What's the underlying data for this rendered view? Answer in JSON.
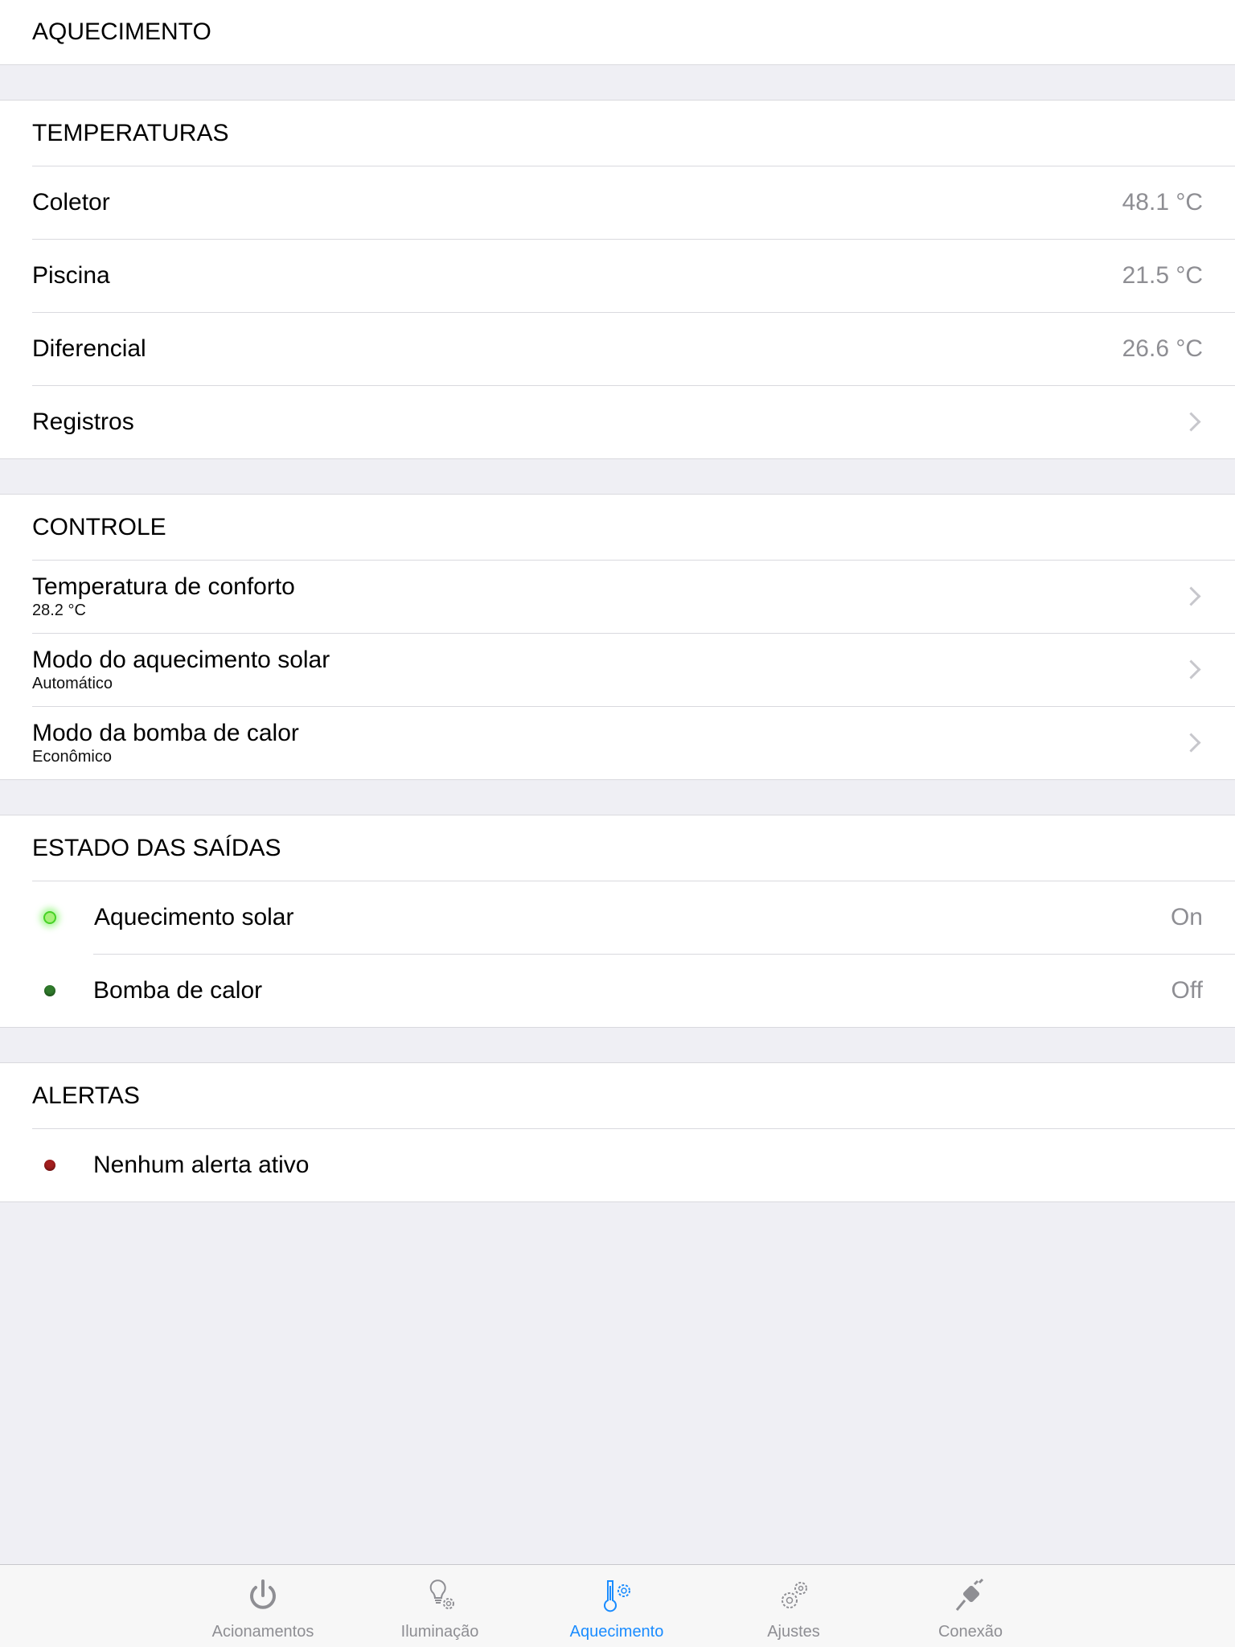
{
  "page_title": "AQUECIMENTO",
  "temperaturas": {
    "header": "TEMPERATURAS",
    "rows": [
      {
        "label": "Coletor",
        "value": "48.1 °C"
      },
      {
        "label": "Piscina",
        "value": "21.5 °C"
      },
      {
        "label": "Diferencial",
        "value": "26.6 °C"
      }
    ],
    "registros_label": "Registros"
  },
  "controle": {
    "header": "CONTROLE",
    "items": [
      {
        "title": "Temperatura de conforto",
        "subtitle": "28.2 °C"
      },
      {
        "title": "Modo do aquecimento solar",
        "subtitle": "Automático"
      },
      {
        "title": "Modo da bomba de calor",
        "subtitle": "Econômico"
      }
    ]
  },
  "estado": {
    "header": "ESTADO DAS SAÍDAS",
    "items": [
      {
        "label": "Aquecimento solar",
        "value": "On"
      },
      {
        "label": "Bomba de calor",
        "value": "Off"
      }
    ]
  },
  "alertas": {
    "header": "ALERTAS",
    "message": "Nenhum alerta ativo"
  },
  "tabs": [
    {
      "label": "Acionamentos",
      "icon": "power-icon"
    },
    {
      "label": "Iluminação",
      "icon": "bulb-gear-icon"
    },
    {
      "label": "Aquecimento",
      "icon": "thermometer-gear-icon"
    },
    {
      "label": "Ajustes",
      "icon": "gears-icon"
    },
    {
      "label": "Conexão",
      "icon": "plug-icon"
    }
  ],
  "colors": {
    "accent": "#1a8cff",
    "led_on": "#46d126",
    "led_off": "#2f7a2b",
    "led_alert": "#a21e1e"
  }
}
